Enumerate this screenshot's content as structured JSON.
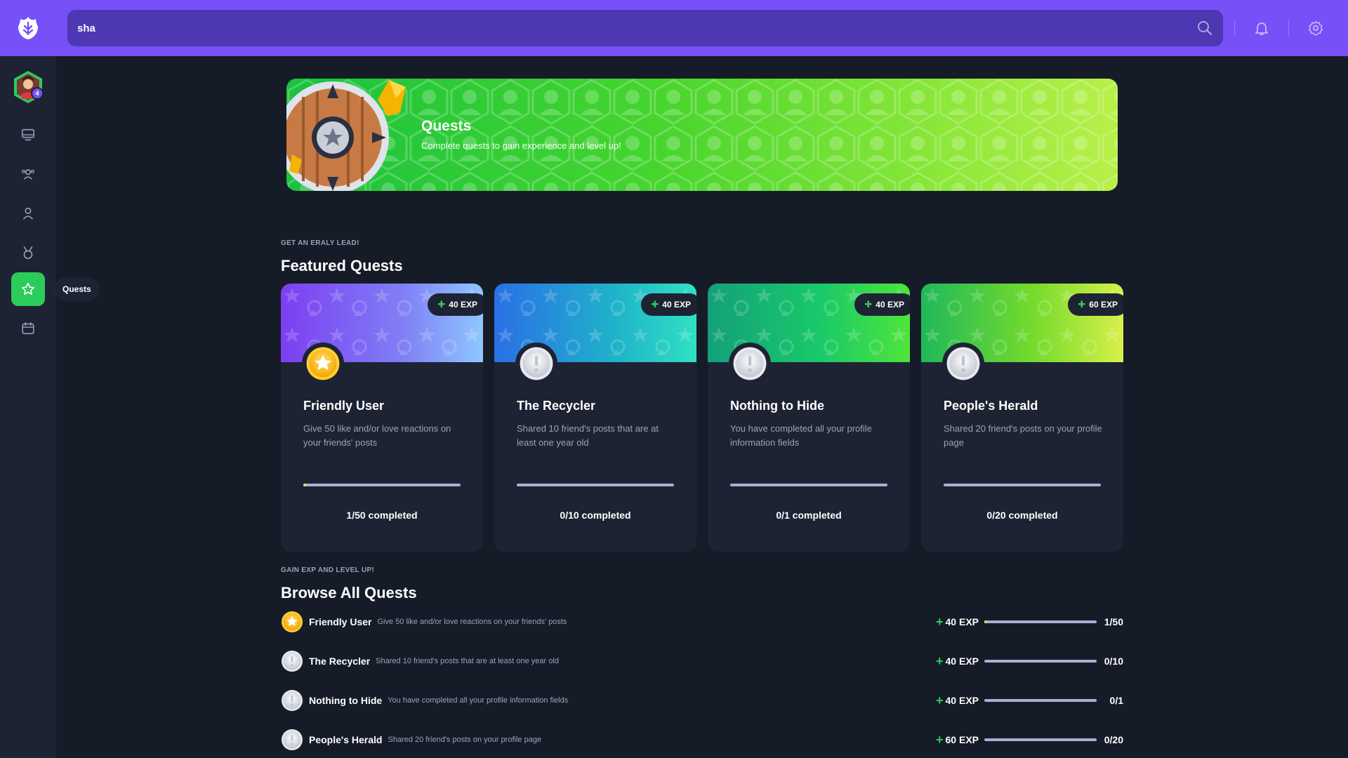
{
  "topbar": {
    "search_value": "sha",
    "icons": [
      "logo-icon",
      "search-icon",
      "bell-icon",
      "gear-icon"
    ]
  },
  "sidebar": {
    "avatar_level": "4",
    "items": [
      {
        "name": "newsfeed",
        "icon": "monitor-icon"
      },
      {
        "name": "friends",
        "icon": "group-icon"
      },
      {
        "name": "profile",
        "icon": "user-icon"
      },
      {
        "name": "badges",
        "icon": "medal-icon"
      },
      {
        "name": "quests",
        "icon": "star-icon",
        "active": true
      },
      {
        "name": "events",
        "icon": "calendar-icon"
      }
    ],
    "tooltip": "Quests"
  },
  "banner": {
    "title": "Quests",
    "subtitle": "Complete quests to gain experience and level up!"
  },
  "featured": {
    "pretitle": "GET AN ERALY LEAD!",
    "title": "Featured Quests",
    "cards": [
      {
        "title": "Friendly User",
        "description": "Give 50 like and/or love reactions on your friends' posts",
        "exp": "40 EXP",
        "status": "1/50 completed",
        "progress": 0.02,
        "medal": "gold"
      },
      {
        "title": "The Recycler",
        "description": "Shared 10 friend's posts that are at least one year old",
        "exp": "40 EXP",
        "status": "0/10 completed",
        "progress": 0,
        "medal": "silver"
      },
      {
        "title": "Nothing to Hide",
        "description": "You have completed all your profile information fields",
        "exp": "40 EXP",
        "status": "0/1 completed",
        "progress": 0,
        "medal": "silver"
      },
      {
        "title": "People's Herald",
        "description": "Shared 20 friend's posts on your profile page",
        "exp": "60 EXP",
        "status": "0/20 completed",
        "progress": 0,
        "medal": "silver"
      }
    ]
  },
  "browse": {
    "pretitle": "GAIN EXP AND LEVEL UP!",
    "title": "Browse All Quests",
    "rows": [
      {
        "title": "Friendly User",
        "description": "Give 50 like and/or love reactions on your friends' posts",
        "exp": "40 EXP",
        "count": "1/50",
        "progress": 0.02,
        "medal": "gold"
      },
      {
        "title": "The Recycler",
        "description": "Shared 10 friend's posts that are at least one year old",
        "exp": "40 EXP",
        "count": "0/10",
        "progress": 0,
        "medal": "silver"
      },
      {
        "title": "Nothing to Hide",
        "description": "You have completed all your profile information fields",
        "exp": "40 EXP",
        "count": "0/1",
        "progress": 0,
        "medal": "silver"
      },
      {
        "title": "People's Herald",
        "description": "Shared 20 friend's posts on your profile page",
        "exp": "60 EXP",
        "count": "0/20",
        "progress": 0,
        "medal": "silver"
      }
    ]
  },
  "colors": {
    "accent": "#7750f8",
    "success": "#2ccc5a",
    "progress": "#c9ff3d"
  }
}
